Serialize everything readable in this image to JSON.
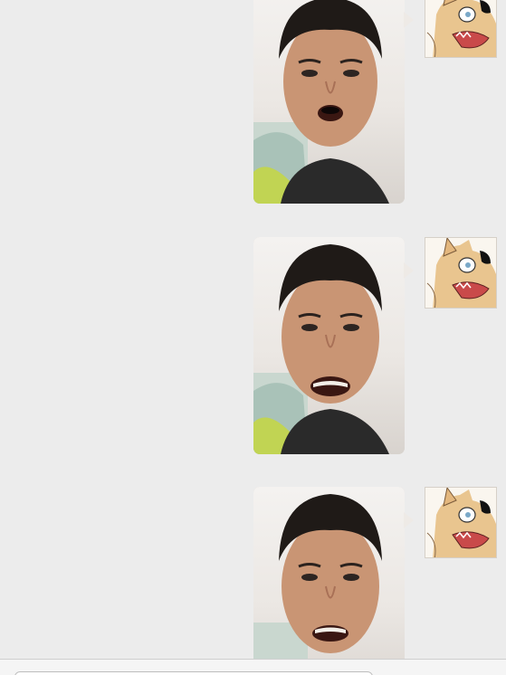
{
  "conversation": {
    "messages": [
      {
        "type": "image",
        "sender": "self",
        "content": "selfie-photo",
        "avatar": "shiba-dog-avatar"
      },
      {
        "type": "image",
        "sender": "self",
        "content": "selfie-photo",
        "avatar": "shiba-dog-avatar"
      },
      {
        "type": "image",
        "sender": "self",
        "content": "selfie-photo",
        "avatar": "shiba-dog-avatar"
      }
    ]
  },
  "input_bar": {
    "placeholder": ""
  },
  "colors": {
    "background": "#ececec",
    "input_bar": "#f5f5f5"
  }
}
